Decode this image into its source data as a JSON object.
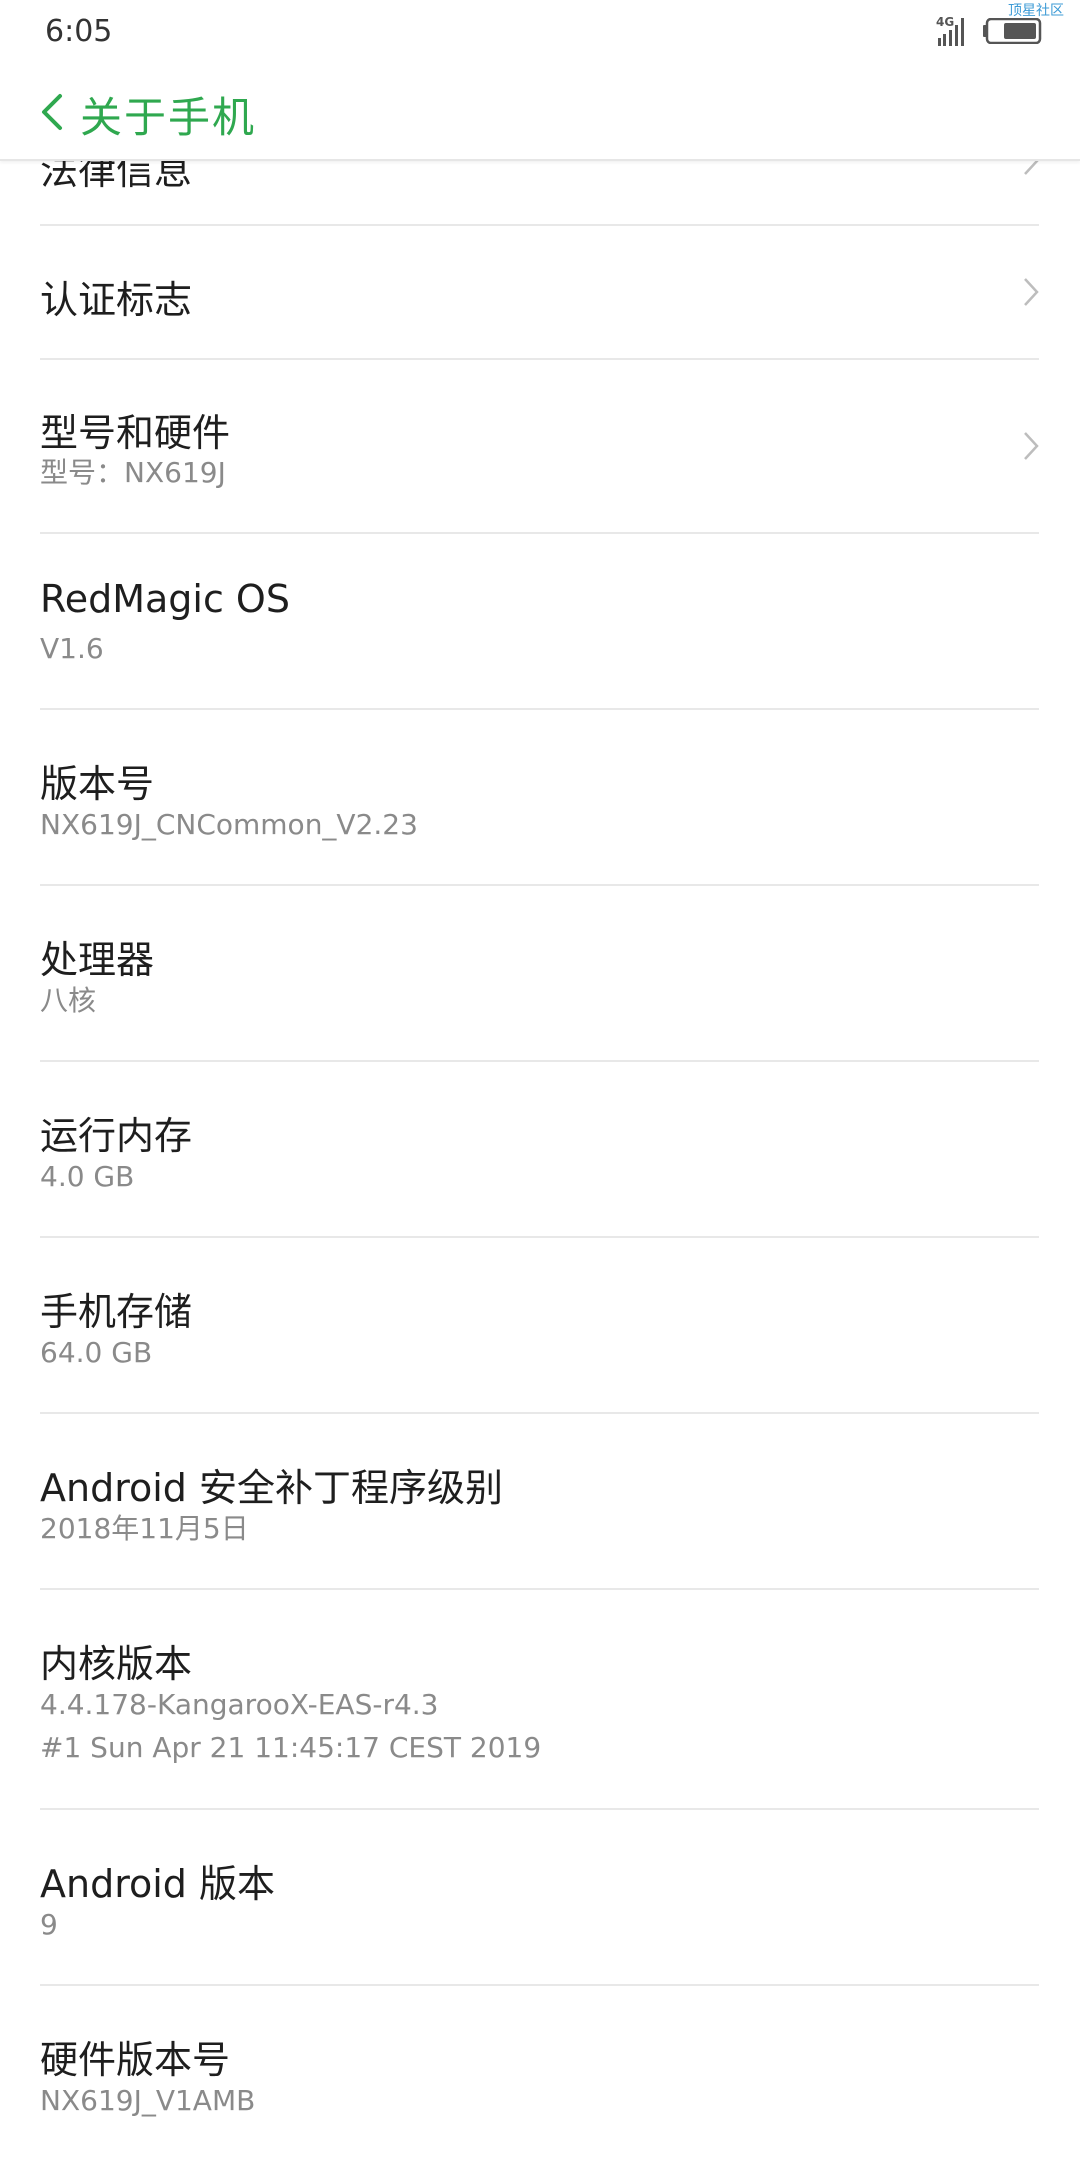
{
  "status_bar": {
    "time": "6:05",
    "watermark": "顶星社区",
    "network_icon": "4g-signal-icon",
    "battery_icon": "battery-icon"
  },
  "header": {
    "title": "关于手机",
    "back_icon": "back-chevron-icon",
    "accent_color": "#2fa84f"
  },
  "items": [
    {
      "title": "法律信息",
      "subtitle": null,
      "has_chevron": true
    },
    {
      "title": "认证标志",
      "subtitle": null,
      "has_chevron": true
    },
    {
      "title": "型号和硬件",
      "subtitle": "型号：NX619J",
      "has_chevron": true
    },
    {
      "title": "RedMagic OS",
      "subtitle": "V1.6",
      "has_chevron": false
    },
    {
      "title": "版本号",
      "subtitle": "NX619J_CNCommon_V2.23",
      "has_chevron": false
    },
    {
      "title": "处理器",
      "subtitle": "八核",
      "has_chevron": false
    },
    {
      "title": "运行内存",
      "subtitle": "4.0 GB",
      "has_chevron": false
    },
    {
      "title": "手机存储",
      "subtitle": "64.0 GB",
      "has_chevron": false
    },
    {
      "title": "Android 安全补丁程序级别",
      "subtitle": "2018年11月5日",
      "has_chevron": false
    },
    {
      "title": "内核版本",
      "subtitle": "4.4.178-KangarooX-EAS-r4.3",
      "subtitle2": "#1 Sun Apr 21 11:45:17 CEST 2019",
      "has_chevron": false
    },
    {
      "title": "Android 版本",
      "subtitle": "9",
      "has_chevron": false
    },
    {
      "title": "硬件版本号",
      "subtitle": "NX619J_V1AMB",
      "has_chevron": false
    }
  ]
}
